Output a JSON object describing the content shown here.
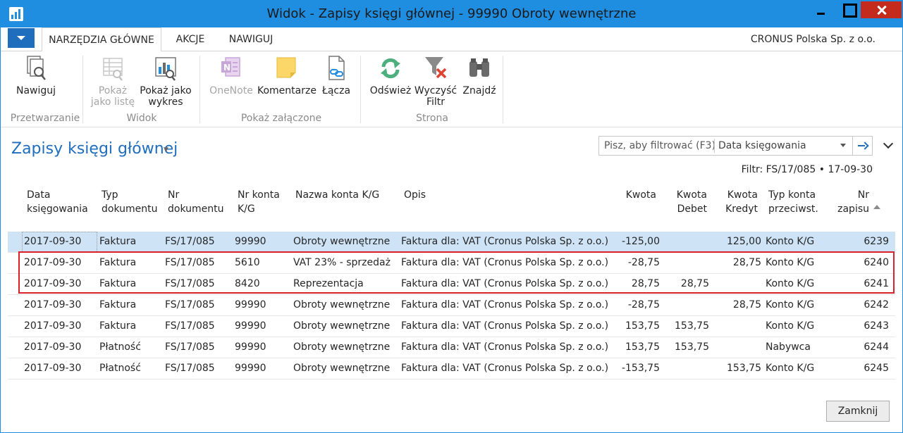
{
  "window": {
    "title": "Widok - Zapisy księgi głównej - 99990 Obroty wewnętrzne"
  },
  "tabs": [
    "NARZĘDZIA GŁÓWNE",
    "AKCJE",
    "NAWIGUJ"
  ],
  "company": "CRONUS Polska Sp. z o.o.",
  "ribbon": {
    "groups": {
      "przetwarzanie": "Przetwarzanie",
      "widok": "Widok",
      "pokaz_zalaczone": "Pokaż załączone",
      "strona": "Strona"
    },
    "buttons": {
      "nawiguj": "Nawiguj",
      "pokaz_liste_1": "Pokaż",
      "pokaz_liste_2": "jako listę",
      "pokaz_wykres_1": "Pokaż jako",
      "pokaz_wykres_2": "wykres",
      "onenote": "OneNote",
      "komentarze": "Komentarze",
      "lacza": "Łącza",
      "odswiez": "Odśwież",
      "wyczysc_1": "Wyczyść",
      "wyczysc_2": "Filtr",
      "znajdz": "Znajdź"
    }
  },
  "page": {
    "title": "Zapisy księgi głównej",
    "filter_placeholder": "Pisz, aby filtrować (F3)",
    "filter_field": "Data księgowania",
    "filter_summary": "Filtr: FS/17/085 • 17-09-30"
  },
  "columns": {
    "data_1": "Data",
    "data_2": "księgowania",
    "typ_1": "Typ",
    "typ_2": "dokumentu",
    "nr_1": "Nr",
    "nr_2": "dokumentu",
    "konto_1": "Nr konta",
    "konto_2": "K/G",
    "nazwa": "Nazwa konta K/G",
    "opis": "Opis",
    "kwota": "Kwota",
    "debet_1": "Kwota",
    "debet_2": "Debet",
    "kredyt_1": "Kwota",
    "kredyt_2": "Kredyt",
    "typ_konta_1": "Typ konta",
    "typ_konta_2": "przeciwst.",
    "zapis_1": "Nr",
    "zapis_2": "zapisu"
  },
  "rows": [
    {
      "data": "2017-09-30",
      "typ": "Faktura",
      "nr": "FS/17/085",
      "konto": "99990",
      "nazwa": "Obroty wewnętrzne",
      "opis": "Faktura dla: VAT (Cronus Polska Sp. z o.o.)",
      "kwota": "-125,00",
      "debet": "",
      "kredyt": "125,00",
      "typ_konta": "Konto K/G",
      "zapis": "6239"
    },
    {
      "data": "2017-09-30",
      "typ": "Faktura",
      "nr": "FS/17/085",
      "konto": "5610",
      "nazwa": "VAT 23% - sprzedaż",
      "opis": "Faktura dla: VAT (Cronus Polska Sp. z o.o.)",
      "kwota": "-28,75",
      "debet": "",
      "kredyt": "28,75",
      "typ_konta": "Konto K/G",
      "zapis": "6240"
    },
    {
      "data": "2017-09-30",
      "typ": "Faktura",
      "nr": "FS/17/085",
      "konto": "8420",
      "nazwa": "Reprezentacja",
      "opis": "Faktura dla: VAT (Cronus Polska Sp. z o.o.)",
      "kwota": "28,75",
      "debet": "28,75",
      "kredyt": "",
      "typ_konta": "Konto K/G",
      "zapis": "6241"
    },
    {
      "data": "2017-09-30",
      "typ": "Faktura",
      "nr": "FS/17/085",
      "konto": "99990",
      "nazwa": "Obroty wewnętrzne",
      "opis": "Faktura dla: VAT (Cronus Polska Sp. z o.o.)",
      "kwota": "-28,75",
      "debet": "",
      "kredyt": "28,75",
      "typ_konta": "Konto K/G",
      "zapis": "6242"
    },
    {
      "data": "2017-09-30",
      "typ": "Faktura",
      "nr": "FS/17/085",
      "konto": "99990",
      "nazwa": "Obroty wewnętrzne",
      "opis": "Faktura dla: VAT (Cronus Polska Sp. z o.o.)",
      "kwota": "153,75",
      "debet": "153,75",
      "kredyt": "",
      "typ_konta": "Konto K/G",
      "zapis": "6243"
    },
    {
      "data": "2017-09-30",
      "typ": "Płatność",
      "nr": "FS/17/085",
      "konto": "99990",
      "nazwa": "Obroty wewnętrzne",
      "opis": "Faktura dla: VAT (Cronus Polska Sp. z o.o.)",
      "kwota": "153,75",
      "debet": "153,75",
      "kredyt": "",
      "typ_konta": "Nabywca",
      "zapis": "6244"
    },
    {
      "data": "2017-09-30",
      "typ": "Płatność",
      "nr": "FS/17/085",
      "konto": "99990",
      "nazwa": "Obroty wewnętrzne",
      "opis": "Faktura dla: VAT (Cronus Polska Sp. z o.o.)",
      "kwota": "-153,75",
      "debet": "",
      "kredyt": "153,75",
      "typ_konta": "Konto K/G",
      "zapis": "6245"
    }
  ],
  "footer": {
    "close_label": "Zamknij"
  },
  "colors": {
    "titlebar": "#1f8de0",
    "accent": "#1f6ebe",
    "selected_row": "#cfe3f6",
    "highlight_border": "#d9202c",
    "close_button": "#c42b1c"
  }
}
